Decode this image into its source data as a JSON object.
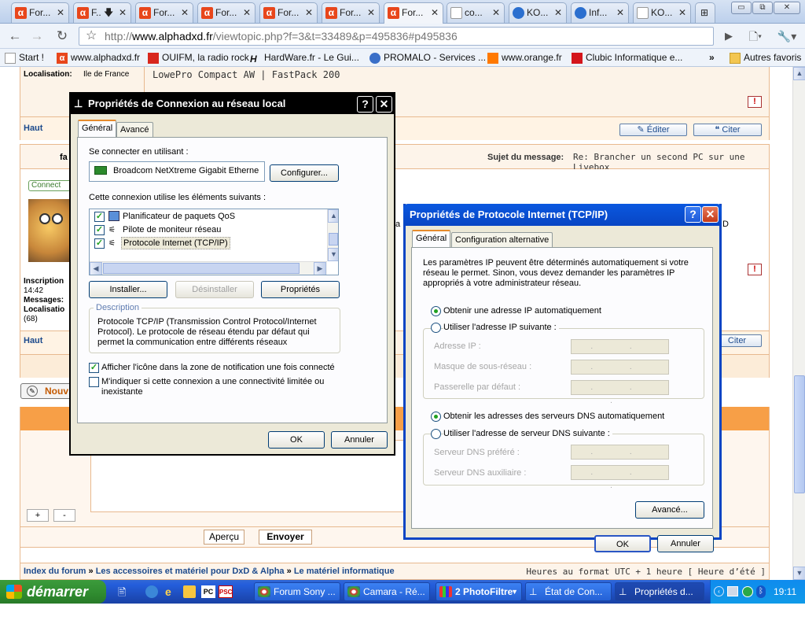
{
  "browser": {
    "tabs": [
      {
        "label": "For...",
        "icon": "alpha-icon"
      },
      {
        "label": "F..",
        "icon": "alpha-icon"
      },
      {
        "label": "For...",
        "icon": "alpha-icon"
      },
      {
        "label": "For...",
        "icon": "alpha-icon"
      },
      {
        "label": "For...",
        "icon": "alpha-icon"
      },
      {
        "label": "For...",
        "icon": "alpha-icon"
      },
      {
        "label": "For...",
        "icon": "alpha-icon",
        "active": true
      },
      {
        "label": "co...",
        "icon": "page-icon"
      },
      {
        "label": "KO...",
        "icon": "globe-icon"
      },
      {
        "label": "Inf...",
        "icon": "globe-icon"
      },
      {
        "label": "KO...",
        "icon": "page-icon"
      }
    ],
    "url_prefix": "http://",
    "url_domain": "www.alphadxd.fr",
    "url_path": "/viewtopic.php?f=3&t=33489&p=495836#p495836",
    "bookmarks": [
      {
        "label": "Start !"
      },
      {
        "label": "www.alphadxd.fr"
      },
      {
        "label": "OUIFM, la radio rock"
      },
      {
        "label": "HardWare.fr - Le Gui..."
      },
      {
        "label": "PROMALO - Services ..."
      },
      {
        "label": "www.orange.fr"
      },
      {
        "label": "Clubic  Informatique e..."
      },
      {
        "label": "Autres favoris"
      }
    ],
    "bookmarks_more": "»"
  },
  "forum": {
    "localisation_label": "Localisation:",
    "localisation_value": "Ile de France",
    "signature": "LowePro Compact AW | FastPack 200",
    "haut": "Haut",
    "editer": "Éditer",
    "citer": "Citer",
    "author_partial": "fa",
    "sujet_label": "Sujet du message:",
    "sujet_value": "Re: Brancher un second PC sur une Livebox",
    "connect_partial": "Connect",
    "inscription_label": "Inscription",
    "inscription_time": "14:42",
    "messages_label": "Messages:",
    "localisation_partial": "Localisatio",
    "count": "(68)",
    "haut2": "Haut",
    "citer2": "Citer",
    "letter_a": "a",
    "letter_d": "D",
    "nouv": "Nouv",
    "plus": "+",
    "minus": "-",
    "apercu": "Aperçu",
    "envoyer": "Envoyer",
    "breadcrumb_1": "Index du forum",
    "breadcrumb_sep": "»",
    "breadcrumb_2": "Les accessoires et matériel pour DxD & Alpha",
    "breadcrumb_3": "Le matériel informatique",
    "timezone": "Heures au format UTC + 1 heure [ Heure d’été ]"
  },
  "dialog1": {
    "title": "Propriétés de Connexion au réseau local",
    "tab_general": "Général",
    "tab_avance": "Avancé",
    "connect_using": "Se connecter en utilisant :",
    "adapter": "Broadcom NetXtreme Gigabit Etherne",
    "configure": "Configurer...",
    "uses_items": "Cette connexion utilise les éléments suivants :",
    "items": [
      {
        "label": "Planificateur de paquets QoS",
        "checked": true
      },
      {
        "label": "Pilote de moniteur réseau",
        "checked": true
      },
      {
        "label": "Protocole Internet (TCP/IP)",
        "checked": true
      }
    ],
    "install": "Installer...",
    "uninstall": "Désinstaller",
    "properties": "Propriétés",
    "description_label": "Description",
    "description": "Protocole TCP/IP (Transmission Control Protocol/Internet Protocol). Le protocole de réseau étendu par défaut qui permet la communication entre différents réseaux interconnectés.",
    "show_icon": "Afficher l'icône dans la zone de notification une fois connecté",
    "show_icon_checked": true,
    "notify_limited": "M'indiquer si cette connexion a une connectivité limitée ou inexistante",
    "notify_limited_checked": false,
    "ok": "OK",
    "cancel": "Annuler"
  },
  "dialog2": {
    "title": "Propriétés de Protocole Internet (TCP/IP)",
    "tab_general": "Général",
    "tab_alt": "Configuration alternative",
    "intro": "Les paramètres IP peuvent être déterminés automatiquement si votre réseau le permet. Sinon, vous devez demander les paramètres IP appropriés à votre administrateur réseau.",
    "auto_ip": "Obtenir une adresse IP automatiquement",
    "use_ip": "Utiliser l'adresse IP suivante :",
    "ip_label": "Adresse IP :",
    "mask_label": "Masque de sous-réseau :",
    "gateway_label": "Passerelle par défaut :",
    "auto_dns": "Obtenir les adresses des serveurs DNS automatiquement",
    "use_dns": "Utiliser l'adresse de serveur DNS suivante :",
    "dns_pref_label": "Serveur DNS préféré :",
    "dns_aux_label": "Serveur DNS auxiliaire :",
    "ip_placeholder": ". . .",
    "advanced": "Avancé...",
    "ok": "OK",
    "cancel": "Annuler"
  },
  "taskbar": {
    "start": "démarrer",
    "tasks": [
      {
        "label": "Forum Sony ..."
      },
      {
        "label": "Camara - Ré..."
      },
      {
        "label": "2 PhotoFiltre"
      },
      {
        "label": "État de Con..."
      },
      {
        "label": "Propriétés d..."
      }
    ],
    "clock": "19:11"
  },
  "colors": {
    "accent_orange": "#e68b2c",
    "forum_link": "#1c4a8c",
    "title_active": "#0a58e0",
    "taskbar_blue": "#245edb",
    "start_green": "#2f8b2f"
  }
}
